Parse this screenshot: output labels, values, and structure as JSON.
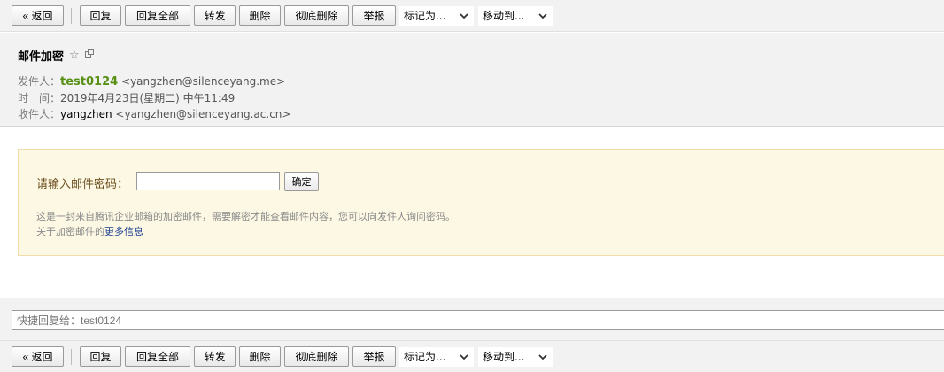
{
  "toolbar": {
    "back": "« 返回",
    "reply": "回复",
    "reply_all": "回复全部",
    "forward": "转发",
    "delete": "删除",
    "delete_permanently": "彻底删除",
    "report": "举报",
    "mark_as": "标记为...",
    "move_to": "移动到..."
  },
  "mail": {
    "subject": "邮件加密",
    "star_icon": "star-icon",
    "window_icon": "new-window-icon",
    "from_label": "发件人：",
    "from_name": "test0124",
    "from_addr": "<yangzhen@silenceyang.me>",
    "time_label": "时　间：",
    "time_value": "2019年4月23日(星期二) 中午11:49",
    "to_label": "收件人：",
    "to_name": "yangzhen",
    "to_addr": "<yangzhen@silenceyang.ac.cn>"
  },
  "encryption": {
    "prompt": "请输入邮件密码：",
    "confirm": "确定",
    "info_line1": "这是一封来自腾讯企业邮箱的加密邮件，需要解密才能查看邮件内容，您可以向发件人询问密码。",
    "info_line2_prefix": "关于加密邮件的",
    "more_info_link": "更多信息"
  },
  "quick_reply": {
    "placeholder": "快捷回复给：test0124"
  },
  "colors": {
    "toolbar_bg": "#f2f2f2",
    "notice_bg": "#fdf8e4",
    "sender_green": "#568f14",
    "link_blue": "#1b3f8f"
  }
}
